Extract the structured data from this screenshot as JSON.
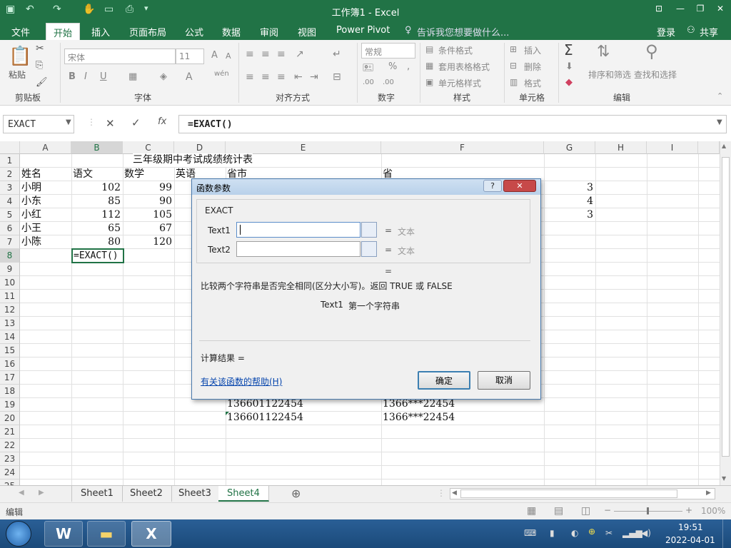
{
  "window": {
    "title": "工作簿1 - Excel"
  },
  "tabs": [
    {
      "label": "文件",
      "active": false
    },
    {
      "label": "开始",
      "active": true
    },
    {
      "label": "插入",
      "active": false
    },
    {
      "label": "页面布局",
      "active": false
    },
    {
      "label": "公式",
      "active": false
    },
    {
      "label": "数据",
      "active": false
    },
    {
      "label": "审阅",
      "active": false
    },
    {
      "label": "视图",
      "active": false
    },
    {
      "label": "Power Pivot",
      "active": false
    }
  ],
  "tellme": "告诉我您想要做什么...",
  "account": {
    "login": "登录",
    "share": "共享"
  },
  "ribbon": {
    "paste": "粘贴",
    "clipboard": "剪贴板",
    "font_name": "宋体",
    "font_size": "11",
    "font_group": "字体",
    "align_group": "对齐方式",
    "number_format": "常规",
    "number_group": "数字",
    "cond_format": "条件格式",
    "table_format": "套用表格格式",
    "cell_styles": "单元格样式",
    "styles_group": "样式",
    "insert": "插入",
    "delete": "删除",
    "format": "格式",
    "cells_group": "单元格",
    "sort_filter": "排序和筛选",
    "find_select": "查找和选择",
    "edit_group": "编辑"
  },
  "formula_bar": {
    "name_box": "EXACT",
    "formula": "=EXACT()"
  },
  "columns": [
    "A",
    "B",
    "C",
    "D",
    "E",
    "F",
    "G",
    "H",
    "I"
  ],
  "rows": [
    "1",
    "2",
    "3",
    "4",
    "5",
    "6",
    "7",
    "8",
    "9",
    "10",
    "11",
    "12",
    "13",
    "14",
    "15",
    "16",
    "17",
    "18",
    "19",
    "20",
    "21",
    "22",
    "23",
    "24",
    "25"
  ],
  "sheet": {
    "title": "三年级期中考试成绩统计表",
    "headers": [
      "姓名",
      "语文",
      "数学",
      "英语",
      "省市",
      "省"
    ],
    "data": [
      {
        "name": "小明",
        "chinese": "102",
        "math": "99",
        "g": "3"
      },
      {
        "name": "小东",
        "chinese": "85",
        "math": "90",
        "g": "4"
      },
      {
        "name": "小红",
        "chinese": "112",
        "math": "105",
        "g": "3"
      },
      {
        "name": "小王",
        "chinese": "65",
        "math": "67",
        "g": ""
      },
      {
        "name": "小陈",
        "chinese": "80",
        "math": "120",
        "g": ""
      }
    ],
    "editing_cell": "=EXACT()",
    "row19_e": "136601122454",
    "row19_f": "1366***22454",
    "row20_e": "136601122454",
    "row20_f": "1366***22454"
  },
  "dialog": {
    "title": "函数参数",
    "function": "EXACT",
    "arg1": "Text1",
    "arg2": "Text2",
    "eq": "=",
    "arg_hint": "文本",
    "description": "比较两个字符串是否完全相同(区分大小写)。返回 TRUE 或 FALSE",
    "arg_desc_name": "Text1",
    "arg_desc": "第一个字符串",
    "result_label": "计算结果 =",
    "help_link": "有关该函数的帮助(H)",
    "ok": "确定",
    "cancel": "取消"
  },
  "sheet_tabs": [
    {
      "label": "Sheet1",
      "active": false
    },
    {
      "label": "Sheet2",
      "active": false
    },
    {
      "label": "Sheet3",
      "active": false
    },
    {
      "label": "Sheet4",
      "active": true
    }
  ],
  "status": {
    "mode": "编辑",
    "zoom": "100%"
  },
  "taskbar": {
    "time": "19:51",
    "date": "2022-04-01"
  },
  "colors": {
    "excel_green": "#217346",
    "accent_blue": "#4a7aad"
  }
}
